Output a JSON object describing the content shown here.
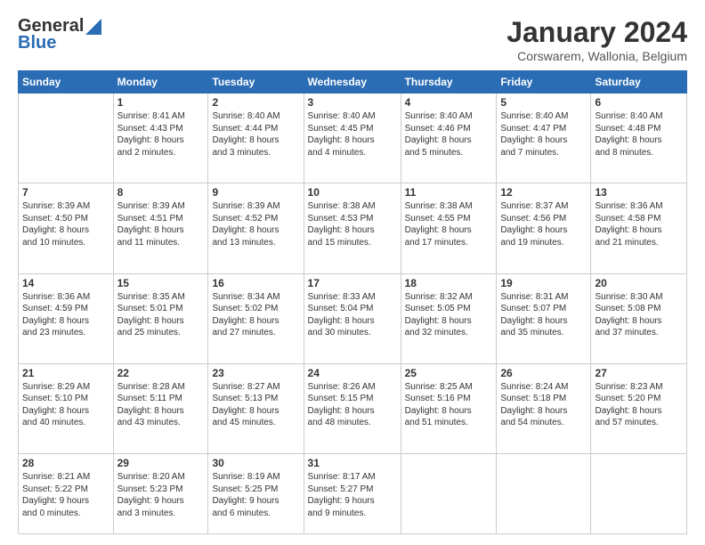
{
  "header": {
    "logo_line1_general": "General",
    "logo_line2": "Blue",
    "month_title": "January 2024",
    "subtitle": "Corswarem, Wallonia, Belgium"
  },
  "days_of_week": [
    "Sunday",
    "Monday",
    "Tuesday",
    "Wednesday",
    "Thursday",
    "Friday",
    "Saturday"
  ],
  "weeks": [
    [
      {
        "day": "",
        "info": ""
      },
      {
        "day": "1",
        "info": "Sunrise: 8:41 AM\nSunset: 4:43 PM\nDaylight: 8 hours\nand 2 minutes."
      },
      {
        "day": "2",
        "info": "Sunrise: 8:40 AM\nSunset: 4:44 PM\nDaylight: 8 hours\nand 3 minutes."
      },
      {
        "day": "3",
        "info": "Sunrise: 8:40 AM\nSunset: 4:45 PM\nDaylight: 8 hours\nand 4 minutes."
      },
      {
        "day": "4",
        "info": "Sunrise: 8:40 AM\nSunset: 4:46 PM\nDaylight: 8 hours\nand 5 minutes."
      },
      {
        "day": "5",
        "info": "Sunrise: 8:40 AM\nSunset: 4:47 PM\nDaylight: 8 hours\nand 7 minutes."
      },
      {
        "day": "6",
        "info": "Sunrise: 8:40 AM\nSunset: 4:48 PM\nDaylight: 8 hours\nand 8 minutes."
      }
    ],
    [
      {
        "day": "7",
        "info": "Sunrise: 8:39 AM\nSunset: 4:50 PM\nDaylight: 8 hours\nand 10 minutes."
      },
      {
        "day": "8",
        "info": "Sunrise: 8:39 AM\nSunset: 4:51 PM\nDaylight: 8 hours\nand 11 minutes."
      },
      {
        "day": "9",
        "info": "Sunrise: 8:39 AM\nSunset: 4:52 PM\nDaylight: 8 hours\nand 13 minutes."
      },
      {
        "day": "10",
        "info": "Sunrise: 8:38 AM\nSunset: 4:53 PM\nDaylight: 8 hours\nand 15 minutes."
      },
      {
        "day": "11",
        "info": "Sunrise: 8:38 AM\nSunset: 4:55 PM\nDaylight: 8 hours\nand 17 minutes."
      },
      {
        "day": "12",
        "info": "Sunrise: 8:37 AM\nSunset: 4:56 PM\nDaylight: 8 hours\nand 19 minutes."
      },
      {
        "day": "13",
        "info": "Sunrise: 8:36 AM\nSunset: 4:58 PM\nDaylight: 8 hours\nand 21 minutes."
      }
    ],
    [
      {
        "day": "14",
        "info": "Sunrise: 8:36 AM\nSunset: 4:59 PM\nDaylight: 8 hours\nand 23 minutes."
      },
      {
        "day": "15",
        "info": "Sunrise: 8:35 AM\nSunset: 5:01 PM\nDaylight: 8 hours\nand 25 minutes."
      },
      {
        "day": "16",
        "info": "Sunrise: 8:34 AM\nSunset: 5:02 PM\nDaylight: 8 hours\nand 27 minutes."
      },
      {
        "day": "17",
        "info": "Sunrise: 8:33 AM\nSunset: 5:04 PM\nDaylight: 8 hours\nand 30 minutes."
      },
      {
        "day": "18",
        "info": "Sunrise: 8:32 AM\nSunset: 5:05 PM\nDaylight: 8 hours\nand 32 minutes."
      },
      {
        "day": "19",
        "info": "Sunrise: 8:31 AM\nSunset: 5:07 PM\nDaylight: 8 hours\nand 35 minutes."
      },
      {
        "day": "20",
        "info": "Sunrise: 8:30 AM\nSunset: 5:08 PM\nDaylight: 8 hours\nand 37 minutes."
      }
    ],
    [
      {
        "day": "21",
        "info": "Sunrise: 8:29 AM\nSunset: 5:10 PM\nDaylight: 8 hours\nand 40 minutes."
      },
      {
        "day": "22",
        "info": "Sunrise: 8:28 AM\nSunset: 5:11 PM\nDaylight: 8 hours\nand 43 minutes."
      },
      {
        "day": "23",
        "info": "Sunrise: 8:27 AM\nSunset: 5:13 PM\nDaylight: 8 hours\nand 45 minutes."
      },
      {
        "day": "24",
        "info": "Sunrise: 8:26 AM\nSunset: 5:15 PM\nDaylight: 8 hours\nand 48 minutes."
      },
      {
        "day": "25",
        "info": "Sunrise: 8:25 AM\nSunset: 5:16 PM\nDaylight: 8 hours\nand 51 minutes."
      },
      {
        "day": "26",
        "info": "Sunrise: 8:24 AM\nSunset: 5:18 PM\nDaylight: 8 hours\nand 54 minutes."
      },
      {
        "day": "27",
        "info": "Sunrise: 8:23 AM\nSunset: 5:20 PM\nDaylight: 8 hours\nand 57 minutes."
      }
    ],
    [
      {
        "day": "28",
        "info": "Sunrise: 8:21 AM\nSunset: 5:22 PM\nDaylight: 9 hours\nand 0 minutes."
      },
      {
        "day": "29",
        "info": "Sunrise: 8:20 AM\nSunset: 5:23 PM\nDaylight: 9 hours\nand 3 minutes."
      },
      {
        "day": "30",
        "info": "Sunrise: 8:19 AM\nSunset: 5:25 PM\nDaylight: 9 hours\nand 6 minutes."
      },
      {
        "day": "31",
        "info": "Sunrise: 8:17 AM\nSunset: 5:27 PM\nDaylight: 9 hours\nand 9 minutes."
      },
      {
        "day": "",
        "info": ""
      },
      {
        "day": "",
        "info": ""
      },
      {
        "day": "",
        "info": ""
      }
    ]
  ]
}
